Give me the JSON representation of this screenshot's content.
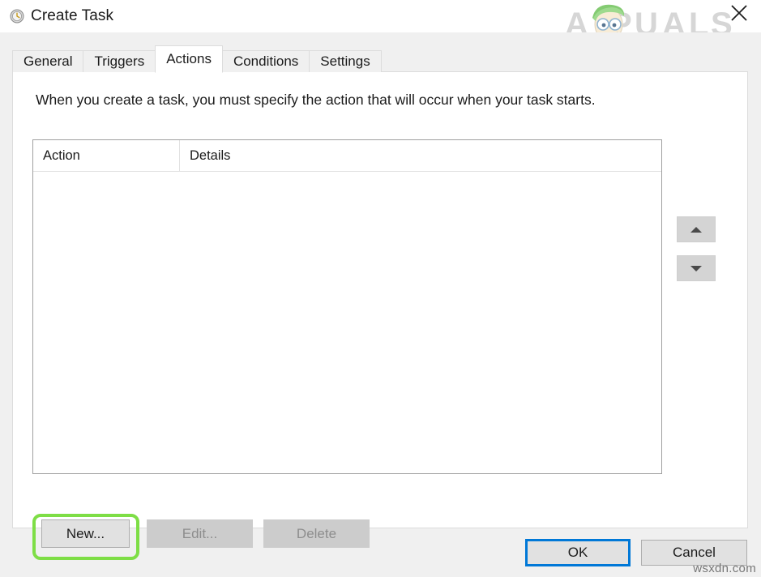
{
  "window": {
    "title": "Create Task",
    "icon": "clock-icon",
    "close_label": "close-icon"
  },
  "watermarks": {
    "brand_text": "APPUALS",
    "site_text": "wsxdn.com"
  },
  "tabs": [
    {
      "label": "General",
      "active": false
    },
    {
      "label": "Triggers",
      "active": false
    },
    {
      "label": "Actions",
      "active": true
    },
    {
      "label": "Conditions",
      "active": false
    },
    {
      "label": "Settings",
      "active": false
    }
  ],
  "panel": {
    "instruction": "When you create a task, you must specify the action that will occur when your task starts."
  },
  "listview": {
    "columns": [
      {
        "key": "action",
        "label": "Action"
      },
      {
        "key": "details",
        "label": "Details"
      }
    ],
    "rows": []
  },
  "move_buttons": {
    "up_label": "move-up",
    "down_label": "move-down"
  },
  "action_buttons": [
    {
      "id": "new",
      "label": "New...",
      "enabled": true,
      "highlighted": true
    },
    {
      "id": "edit",
      "label": "Edit...",
      "enabled": false,
      "highlighted": false
    },
    {
      "id": "delete",
      "label": "Delete",
      "enabled": false,
      "highlighted": false
    }
  ],
  "footer": {
    "ok_label": "OK",
    "cancel_label": "Cancel",
    "default_button": "OK"
  },
  "colors": {
    "highlight_green": "#7ede46",
    "focus_blue": "#0078d7",
    "dialog_bg": "#f0f0f0",
    "panel_bg": "#ffffff",
    "button_bg": "#e1e1e1",
    "button_disabled_bg": "#cccccc"
  }
}
